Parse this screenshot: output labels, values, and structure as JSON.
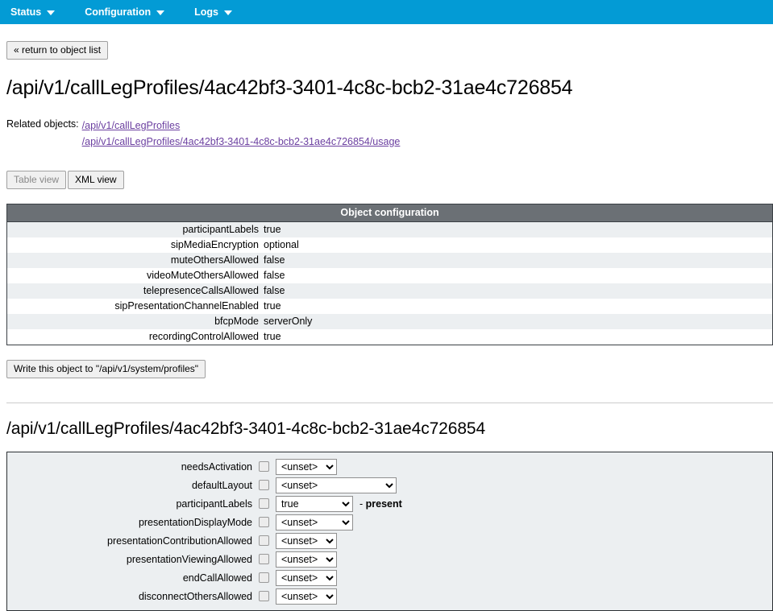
{
  "nav": {
    "items": [
      {
        "label": "Status",
        "icon": "chevron-down-icon"
      },
      {
        "label": "Configuration",
        "icon": "chevron-down-icon"
      },
      {
        "label": "Logs",
        "icon": "chevron-down-icon"
      }
    ],
    "accent_color": "#039bd5"
  },
  "return_button": {
    "label": "« return to object list"
  },
  "page_title": "/api/v1/callLegProfiles/4ac42bf3-3401-4c8c-bcb2-31ae4c726854",
  "related": {
    "label": "Related objects:",
    "links": [
      "/api/v1/callLegProfiles",
      "/api/v1/callLegProfiles/4ac42bf3-3401-4c8c-bcb2-31ae4c726854/usage"
    ],
    "link_color": "#6b3fa0"
  },
  "view_tabs": [
    {
      "label": "Table view",
      "selected": true,
      "disabled": true
    },
    {
      "label": "XML view",
      "selected": false,
      "disabled": false
    }
  ],
  "object_configuration": {
    "header": "Object configuration",
    "header_bg": "#6b7075",
    "rows": [
      {
        "key": "participantLabels",
        "value": "true"
      },
      {
        "key": "sipMediaEncryption",
        "value": "optional"
      },
      {
        "key": "muteOthersAllowed",
        "value": "false"
      },
      {
        "key": "videoMuteOthersAllowed",
        "value": "false"
      },
      {
        "key": "telepresenceCallsAllowed",
        "value": "false"
      },
      {
        "key": "sipPresentationChannelEnabled",
        "value": "true"
      },
      {
        "key": "bfcpMode",
        "value": "serverOnly"
      },
      {
        "key": "recordingControlAllowed",
        "value": "true"
      }
    ]
  },
  "write_button": {
    "label": "Write this object to \"/api/v1/system/profiles\""
  },
  "edit_section": {
    "title": "/api/v1/callLegProfiles/4ac42bf3-3401-4c8c-bcb2-31ae4c726854",
    "fields": [
      {
        "name": "needsActivation",
        "checked": false,
        "value": "<unset>",
        "width": "small",
        "note": ""
      },
      {
        "name": "defaultLayout",
        "checked": false,
        "value": "<unset>",
        "width": "large",
        "note": ""
      },
      {
        "name": "participantLabels",
        "checked": false,
        "value": "true",
        "width": "mid",
        "note": "- present"
      },
      {
        "name": "presentationDisplayMode",
        "checked": false,
        "value": "<unset>",
        "width": "mid",
        "note": ""
      },
      {
        "name": "presentationContributionAllowed",
        "checked": false,
        "value": "<unset>",
        "width": "small",
        "note": ""
      },
      {
        "name": "presentationViewingAllowed",
        "checked": false,
        "value": "<unset>",
        "width": "small",
        "note": ""
      },
      {
        "name": "endCallAllowed",
        "checked": false,
        "value": "<unset>",
        "width": "small",
        "note": ""
      },
      {
        "name": "disconnectOthersAllowed",
        "checked": false,
        "value": "<unset>",
        "width": "small",
        "note": ""
      }
    ]
  }
}
